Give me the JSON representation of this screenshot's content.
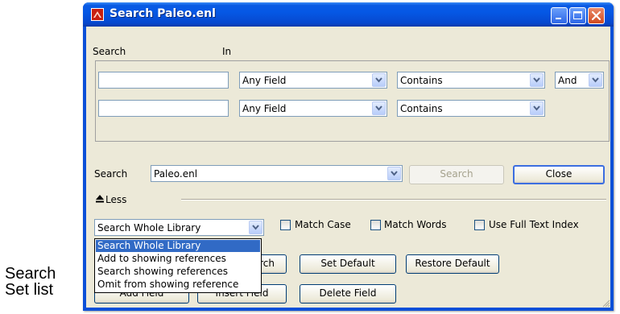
{
  "window": {
    "title": "Search Paleo.enl"
  },
  "criteria": {
    "search_header": "Search",
    "in_header": "In",
    "rows": [
      {
        "text": "",
        "field": "Any Field",
        "operator": "Contains",
        "bool": "And"
      },
      {
        "text": "",
        "field": "Any Field",
        "operator": "Contains"
      }
    ]
  },
  "search_in": {
    "label": "Search",
    "value": "Paleo.enl"
  },
  "buttons": {
    "search": "Search",
    "close": "Close",
    "search_obscured": "rch",
    "set_default": "Set Default",
    "restore_default": "Restore Default",
    "add_field": "Add Field",
    "insert_field": "Insert Field",
    "delete_field": "Delete Field"
  },
  "less": {
    "label": "Less"
  },
  "options": {
    "scope_selected": "Search Whole Library",
    "match_case": "Match Case",
    "match_words": "Match Words",
    "full_text": "Use Full Text Index"
  },
  "scope_list": [
    "Search Whole Library",
    "Add to showing references",
    "Search showing references",
    "Omit from showing reference"
  ],
  "annotation": {
    "line1": "Search",
    "line2": "Set list"
  },
  "colors": {
    "title_bar": "#0558e5",
    "selection": "#316ac5",
    "dialog_bg": "#ece9d8"
  }
}
